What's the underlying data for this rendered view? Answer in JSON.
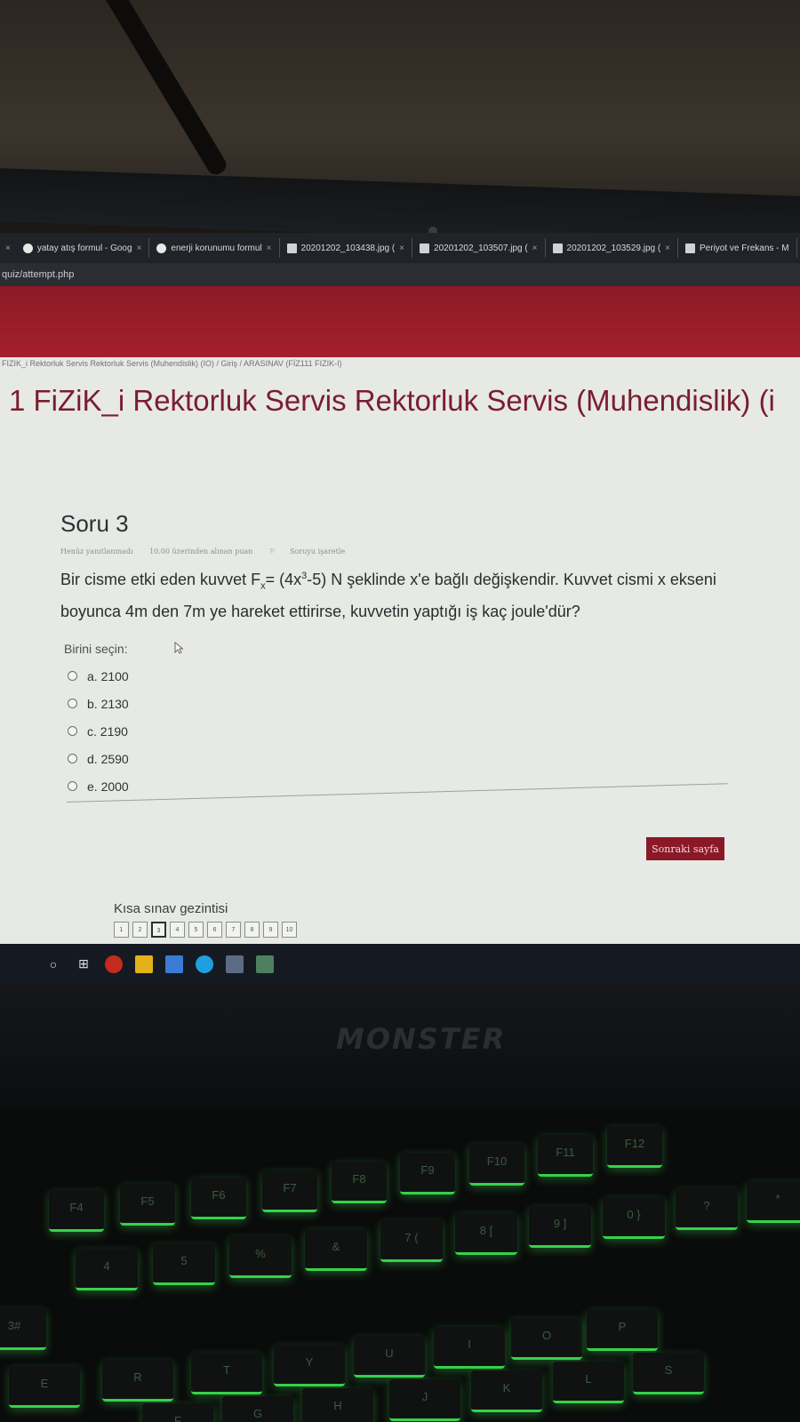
{
  "browser": {
    "tabs": [
      {
        "label": "yatay atış formul - Goog",
        "icon": "google-icon"
      },
      {
        "label": "enerji korunumu formul",
        "icon": "google-icon"
      },
      {
        "label": "20201202_103438.jpg (",
        "icon": "file-icon"
      },
      {
        "label": "20201202_103507.jpg (",
        "icon": "file-icon"
      },
      {
        "label": "20201202_103529.jpg (",
        "icon": "file-icon"
      },
      {
        "label": "Periyot ve Frekans - M",
        "icon": "file-icon"
      }
    ],
    "close_glyph": "×",
    "url": "quiz/attempt.php"
  },
  "breadcrumb": "FIZIK_i Rektorluk Servis Rektorluk Servis (Muhendislik) (IO)  /  Giriş  /  ARASINAV (FİZ111 FIZIK-I)",
  "page_title": "1 FiZiK_i Rektorluk Servis Rektorluk Servis (Muhendislik) (i",
  "question": {
    "heading": "Soru 3",
    "status": "Henüz yanıtlanmadı",
    "marks": "10.00 üzerinden alınan puan",
    "flag_label": "Soruyu işaretle",
    "text_1": "Bir cisme etki eden kuvvet F",
    "text_sub": "x",
    "text_2": "= (4x",
    "text_sup": "3",
    "text_3": "-5) N şeklinde x'e bağlı değişkendir. Kuvvet cismi x ekseni boyunca 4m den 7m ye hareket ettirirse, kuvvetin yaptığı iş kaç joule'dür?",
    "choose_label": "Birini seçin:",
    "options": [
      "a. 2100",
      "b. 2130",
      "c. 2190",
      "d. 2590",
      "e. 2000"
    ]
  },
  "next_button": "Sonraki sayfa",
  "quiz_nav": {
    "title": "Kısa sınav gezintisi",
    "pages": [
      "1",
      "2",
      "3",
      "4",
      "5",
      "6",
      "7",
      "8",
      "9",
      "10"
    ],
    "current": "3"
  },
  "taskbar": {
    "start_glyph": "○",
    "taskview_glyph": "⊞"
  },
  "laptop_brand": "MONSTER",
  "keys": [
    "F4",
    "F5",
    "F6",
    "F7",
    "F8",
    "F9",
    "F10",
    "F11",
    "F12",
    "4",
    "5",
    "%",
    "&",
    "7 (",
    "8 [",
    "9 ]",
    "0 }",
    "?",
    "*",
    "3#",
    "E",
    "R",
    "T",
    "Y",
    "U",
    "I",
    "O",
    "P",
    "F",
    "G",
    "H",
    "J",
    "K",
    "L",
    "S"
  ],
  "colors": {
    "accent": "#8b1827",
    "title": "#7a1d30",
    "keyboard_glow": "#35d24a"
  }
}
